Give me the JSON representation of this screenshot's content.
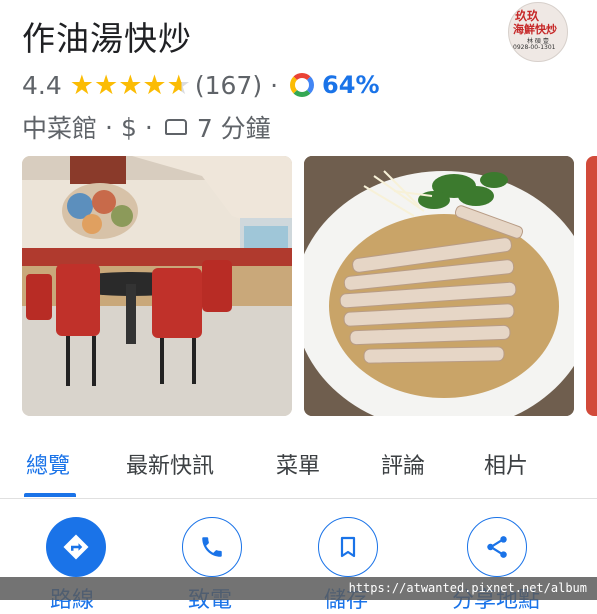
{
  "place": {
    "title": "作油湯快炒",
    "rating": "4.4",
    "stars_value": 4.4,
    "review_count": "(167)",
    "match_percent": "64%",
    "category": "中菜館",
    "price": "$",
    "drive_time": "7 分鐘",
    "separator": "·"
  },
  "logo": {
    "line1": "玖玖",
    "line2": "海鮮快炒",
    "line3": "林 碩 壹",
    "line4": "0928-00-1301"
  },
  "tabs": [
    {
      "label": "總覽",
      "active": true
    },
    {
      "label": "最新快訊",
      "active": false
    },
    {
      "label": "菜單",
      "active": false
    },
    {
      "label": "評論",
      "active": false
    },
    {
      "label": "相片",
      "active": false
    }
  ],
  "actions": [
    {
      "label": "路線",
      "icon": "directions-icon"
    },
    {
      "label": "致電",
      "icon": "phone-icon"
    },
    {
      "label": "儲存",
      "icon": "bookmark-icon"
    },
    {
      "label": "分享地點",
      "icon": "share-icon"
    }
  ],
  "watermark": "https://atwanted.pixnet.net/album",
  "colors": {
    "accent": "#1a73e8",
    "star": "#fbbc04",
    "text": "#202124",
    "secondary": "#5f6368"
  }
}
